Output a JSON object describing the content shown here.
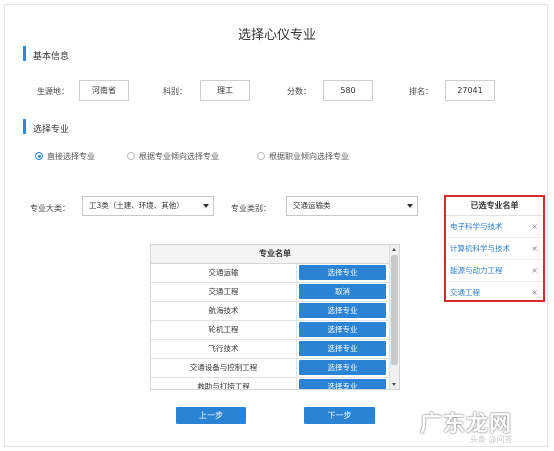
{
  "title": "选择心仪专业",
  "basic_section": {
    "heading": "基本信息",
    "origin_label": "生源地：",
    "origin_value": "河南省",
    "subject_label": "科别：",
    "subject_value": "理工",
    "score_label": "分数：",
    "score_value": "580",
    "rank_label": "排名：",
    "rank_value": "27041"
  },
  "major_section": {
    "heading": "选择专业",
    "radios": [
      {
        "label": "直接选择专业",
        "selected": true
      },
      {
        "label": "根据专业倾向选择专业",
        "selected": false
      },
      {
        "label": "根据职业倾向选择专业",
        "selected": false
      }
    ],
    "category_label": "专业大类：",
    "category_value": "工3类（土建、环境、其他）",
    "type_label": "专业类别：",
    "type_value": "交通运输类"
  },
  "major_table": {
    "header": "专业名单",
    "rows": [
      {
        "name": "交通运输",
        "action": "选择专业"
      },
      {
        "name": "交通工程",
        "action": "取消"
      },
      {
        "name": "航海技术",
        "action": "选择专业"
      },
      {
        "name": "轮机工程",
        "action": "选择专业"
      },
      {
        "name": "飞行技术",
        "action": "选择专业"
      },
      {
        "name": "交通设备与控制工程",
        "action": "选择专业"
      },
      {
        "name": "救助与打捞工程",
        "action": "选择专业"
      }
    ]
  },
  "selected_panel": {
    "header": "已选专业名单",
    "items": [
      "电子科学与技术",
      "计算机科学与技术",
      "能源与动力工程",
      "交通工程"
    ],
    "remove_glyph": "×"
  },
  "nav": {
    "prev_label": "上一步",
    "next_label": "下一步"
  },
  "watermark": {
    "main": "广东龙网",
    "sub": "头条 @问答"
  },
  "colors": {
    "accent": "#2a83d5",
    "section_bar": "#2f8bd8",
    "highlight_border": "#d92b2b",
    "link": "#2a7ed0"
  }
}
